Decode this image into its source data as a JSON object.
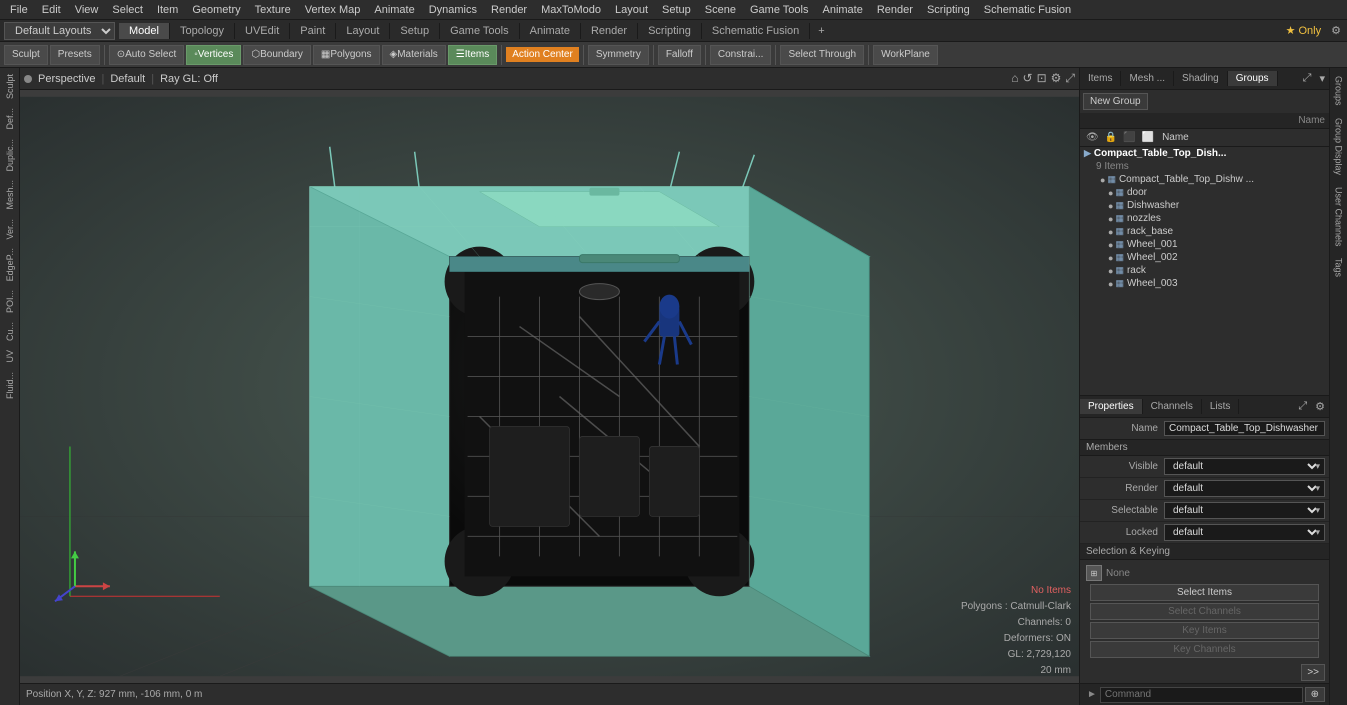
{
  "menu": {
    "items": [
      "File",
      "Edit",
      "View",
      "Select",
      "Item",
      "Geometry",
      "Texture",
      "Vertex Map",
      "Animate",
      "Dynamics",
      "Render",
      "MaxToModo",
      "Layout",
      "Setup",
      "Scene",
      "Game Tools",
      "Animate",
      "Render",
      "Scripting",
      "Schematic Fusion"
    ]
  },
  "layout": {
    "selector": "Default Layouts",
    "tabs": [
      "Sculpt",
      "Def...",
      "Duplic...",
      "Mesh...",
      "Ver...",
      "EdgeP...",
      "POI...",
      "Cu...",
      "UV",
      "Fluid..."
    ],
    "mode_tabs": [
      "Model",
      "Topology",
      "UVEdit",
      "Paint",
      "Layout",
      "Setup",
      "Game Tools",
      "Animate",
      "Render",
      "Scripting",
      "Schematic Fusion"
    ],
    "active_mode": "Model",
    "star_only": "★ Only"
  },
  "toolbar": {
    "sculpt_label": "Sculpt",
    "presets_label": "Presets",
    "auto_select_label": "Auto Select",
    "vertices_label": "Vertices",
    "boundary_label": "Boundary",
    "polygons_label": "Polygons",
    "materials_label": "Materials",
    "items_label": "Items",
    "action_center_label": "Action Center",
    "symmetry_label": "Symmetry",
    "falloff_label": "Falloff",
    "constraints_label": "Constrai...",
    "select_through_label": "Select Through",
    "workplane_label": "WorkPlane"
  },
  "viewport": {
    "dot_color": "#888",
    "view_label": "Perspective",
    "scene_label": "Default",
    "ray_label": "Ray GL: Off",
    "status_no_items": "No Items",
    "polygons": "Polygons : Catmull-Clark",
    "channels": "Channels: 0",
    "deformers": "Deformers: ON",
    "gl": "GL: 2,729,120",
    "mm": "20 mm",
    "position": "Position X, Y, Z:  927 mm, -106 mm, 0 m"
  },
  "right_panel": {
    "tabs": [
      "Items",
      "Mesh ...",
      "Shading",
      "Groups"
    ],
    "active_tab": "Groups",
    "new_group_btn": "New Group",
    "col_name": "Name",
    "group_root": "Compact_Table_Top_Dish...",
    "item_count": "9 Items",
    "items": [
      {
        "name": "Compact_Table_Top_Dishw ...",
        "indent": 1
      },
      {
        "name": "door",
        "indent": 2
      },
      {
        "name": "Dishwasher",
        "indent": 2
      },
      {
        "name": "nozzles",
        "indent": 2
      },
      {
        "name": "rack_base",
        "indent": 2
      },
      {
        "name": "Wheel_001",
        "indent": 2
      },
      {
        "name": "Wheel_002",
        "indent": 2
      },
      {
        "name": "rack",
        "indent": 2
      },
      {
        "name": "Wheel_003",
        "indent": 2
      }
    ]
  },
  "properties": {
    "tabs": [
      "Properties",
      "Channels",
      "Lists"
    ],
    "active_tab": "Properties",
    "name_label": "Name",
    "name_value": "Compact_Table_Top_Dishwasher",
    "members_label": "Members",
    "fields": [
      {
        "key": "Visible",
        "value": "default"
      },
      {
        "key": "Render",
        "value": "default"
      },
      {
        "key": "Selectable",
        "value": "default"
      },
      {
        "key": "Locked",
        "value": "default"
      }
    ],
    "selection_keying": "Selection & Keying",
    "keying_label": "None",
    "select_items_btn": "Select Items",
    "select_channels_btn": "Select Channels",
    "key_items_btn": "Key Items",
    "key_channels_btn": "Key Channels"
  },
  "command_bar": {
    "placeholder": "Command",
    "arrow_label": "►"
  },
  "right_edge_tabs": [
    "Groups",
    "Group Display",
    "User Channels",
    "Tags"
  ],
  "gizmo": {
    "x_color": "#ff4444",
    "y_color": "#44ff44",
    "z_color": "#4444ff"
  }
}
